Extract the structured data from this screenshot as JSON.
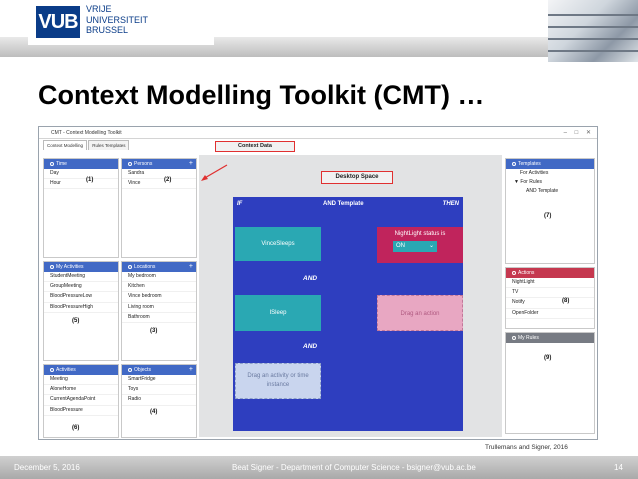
{
  "header": {
    "logo_text": "VUB",
    "university_lines": [
      "VRIJE",
      "UNIVERSITEIT",
      "BRUSSEL"
    ]
  },
  "slide_title": "Context Modelling Toolkit (CMT) …",
  "window": {
    "title": "CMT - Context Modelling Toolkit",
    "controls": "– □ ✕",
    "tabs": [
      "Context Modelling",
      "Rules Templates"
    ]
  },
  "panels": {
    "time": {
      "title": "Time",
      "items": [
        "Day",
        "Hour"
      ],
      "num": "(1)"
    },
    "persons": {
      "title": "Persons",
      "items": [
        "Sandra",
        "Vince"
      ],
      "num": "(2)"
    },
    "my_activities": {
      "title": "My Activities",
      "items": [
        "StudentMeeting",
        "GroupMeeting",
        "BloodPressureLow",
        "BloodPressureHigh"
      ],
      "num": "(5)"
    },
    "locations": {
      "title": "Locations",
      "items": [
        "My bedroom",
        "Kitchen",
        "Vince bedroom",
        "Living room",
        "Bathroom"
      ],
      "num": "(3)"
    },
    "activities": {
      "title": "Activities",
      "items": [
        "Meeting",
        "AloneHome",
        "CurrentAgendaPoint",
        "BloodPressure"
      ],
      "num": "(6)"
    },
    "objects": {
      "title": "Objects",
      "items": [
        "SmartFridge",
        "Toys",
        "Radio"
      ],
      "num": "(4)"
    },
    "templates": {
      "title": "Templates",
      "items": [
        "For Activities",
        "▼ For Rules",
        "AND Template"
      ],
      "num": "(7)"
    },
    "actions": {
      "title": "Actions",
      "items": [
        "NightLight",
        "TV",
        "Notify",
        "OpenFolder"
      ],
      "num": "(8)"
    },
    "my_rules": {
      "title": "My Rules",
      "items": [],
      "num": "(9)"
    }
  },
  "labels": {
    "context_data": "Context Data",
    "desktop_space": "Desktop Space"
  },
  "rule": {
    "if": "IF",
    "template": "AND Template",
    "then": "THEN",
    "cond1": "VinceSleeps",
    "cond2": "ISleep",
    "and": "AND",
    "action_title": "NightLight status is",
    "action_value": "ON",
    "drop_action": "Drag an action",
    "drop_activity": "Drag an activity or time instance"
  },
  "colors": {
    "panel_blue": "#4169c5",
    "panel_red": "#c5384f",
    "rule_blue": "#2e3ebf",
    "teal": "#2aa8b3",
    "magenta": "#c0245c",
    "pink": "#e8a7c2"
  },
  "credit": "Trullemans and Signer, 2016",
  "footer": {
    "date": "December 5, 2016",
    "center": "Beat Signer - Department of Computer Science - bsigner@vub.ac.be",
    "page": "14"
  }
}
